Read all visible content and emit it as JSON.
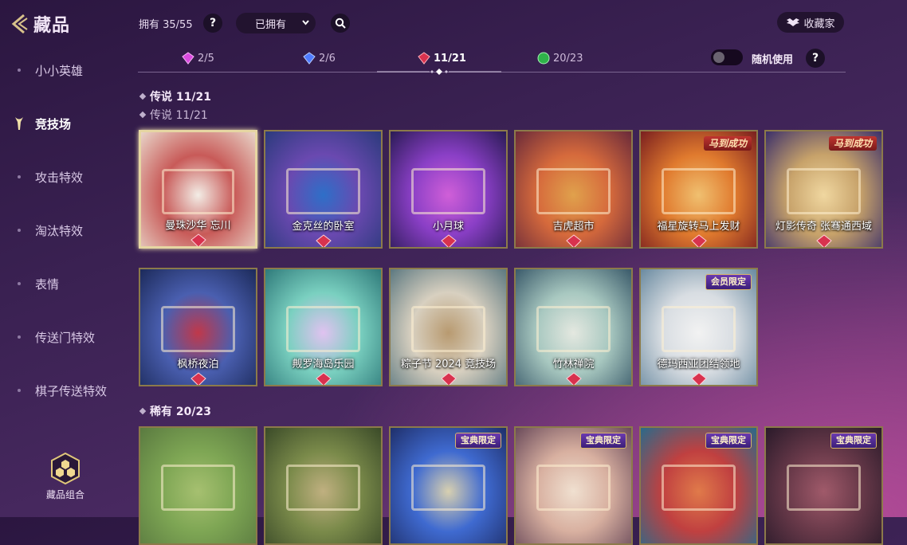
{
  "header": {
    "title": "藏品",
    "owned": "拥有 35/55",
    "help": "?",
    "filter_value": "已拥有",
    "collector_label": "收藏家"
  },
  "sidebar": {
    "items": [
      {
        "label": "小小英雄"
      },
      {
        "label": "竞技场",
        "active": true
      },
      {
        "label": "攻击特效"
      },
      {
        "label": "淘汰特效"
      },
      {
        "label": "表情"
      },
      {
        "label": "传送门特效"
      },
      {
        "label": "棋子传送特效"
      }
    ],
    "combo_label": "藏品组合"
  },
  "gem_tabs": [
    {
      "label": "2/5",
      "color": "#d94adf"
    },
    {
      "label": "2/6",
      "color": "#4f7bff"
    },
    {
      "label": "11/21",
      "color": "#d8324e",
      "active": true
    },
    {
      "label": "20/23",
      "color": "#2fb34a"
    }
  ],
  "random_use": {
    "label": "随机使用",
    "enabled": false,
    "help": "?"
  },
  "sections": {
    "legendary": "传说  11/21",
    "legendary_ghost": "传说  11/21",
    "rare": "稀有  20/23"
  },
  "cards": [
    {
      "label": "曼珠沙华  忘川",
      "selected": true,
      "colors": [
        "#e8d4c8",
        "#c85a58",
        "#f3ede6"
      ]
    },
    {
      "label": "金克丝的卧室",
      "colors": [
        "#2b3a7c",
        "#6a49b0",
        "#2e6fc8"
      ]
    },
    {
      "label": "小月球",
      "colors": [
        "#2a1b55",
        "#8a3fc6",
        "#d05fd8"
      ]
    },
    {
      "label": "吉虎超市",
      "colors": [
        "#6a2a3a",
        "#d66a3c",
        "#e0a14c"
      ]
    },
    {
      "label": "福星旋转马上发财",
      "badge": "马到成功",
      "colors": [
        "#7a1f1f",
        "#e07a2e",
        "#f0c070"
      ]
    },
    {
      "label": "灯影传奇  张骞通西域",
      "badge": "马到成功",
      "colors": [
        "#3b2f6a",
        "#c7a26a",
        "#f0d7a0"
      ]
    },
    {
      "label": "枫桥夜泊",
      "colors": [
        "#1c2a5a",
        "#4a5fb0",
        "#c0384a"
      ]
    },
    {
      "label": "觍罗海岛乐园",
      "colors": [
        "#2f7a7a",
        "#7ad0c0",
        "#e0c2f0"
      ]
    },
    {
      "label": "粽子节  2024  竞技场",
      "colors": [
        "#5c7880",
        "#d8d0c0",
        "#b89a70"
      ]
    },
    {
      "label": "竹林禅院",
      "colors": [
        "#3a5a6a",
        "#a8c8c0",
        "#e4e8e0"
      ]
    },
    {
      "label": "德玛西亚团结领地",
      "badge": "会员限定",
      "colors": [
        "#6a8aa0",
        "#d8dde2",
        "#f2f2f2"
      ]
    },
    {
      "label": "",
      "colors": [
        "#5a7a40",
        "#7ea654",
        "#a6c070"
      ]
    },
    {
      "label": "",
      "colors": [
        "#3a4a28",
        "#7a8a4a",
        "#c0b080"
      ]
    },
    {
      "label": "",
      "badge": "宝典限定",
      "colors": [
        "#1f2f6a",
        "#3f6ad0",
        "#d8d0b0"
      ]
    },
    {
      "label": "",
      "badge": "宝典限定",
      "colors": [
        "#6a4a5a",
        "#d8b0a0",
        "#f0e0d0"
      ]
    },
    {
      "label": "",
      "badge": "宝典限定",
      "colors": [
        "#2a6a8a",
        "#c04040",
        "#e07a4a"
      ]
    },
    {
      "label": "",
      "badge": "宝典限定",
      "colors": [
        "#2a1a2a",
        "#6a3a4a",
        "#a05a6a"
      ]
    }
  ],
  "colors": {
    "accent_gold": "#e6d6a2",
    "legendary_gem": "#d8324e"
  }
}
